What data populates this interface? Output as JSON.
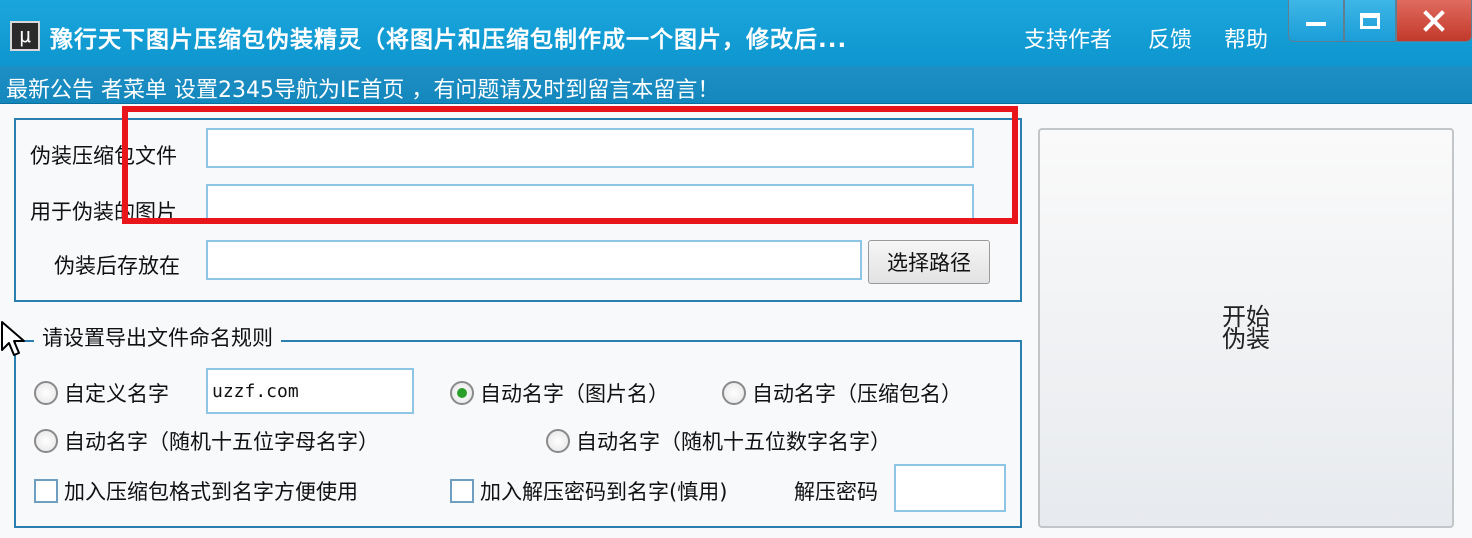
{
  "window": {
    "app_icon": "app-icon",
    "title": "豫行天下图片压缩包伪装精灵（将图片和压缩包制作成一个图片，修改后...",
    "links": {
      "support": "支持作者",
      "feedback": "反馈",
      "help": "帮助"
    },
    "controls": [
      "minimize-icon",
      "maximize-icon",
      "close-icon"
    ]
  },
  "notice": {
    "text": "最新公告 者菜单 设置2345导航为IE首页 ，有问题请及时到留言本留言！"
  },
  "files": {
    "archive_label": "伪装压缩包文件",
    "archive_value": "",
    "image_label": "用于伪装的图片",
    "image_value": "",
    "output_label": "伪装后存放在",
    "output_value": "",
    "browse_button": "选择路径"
  },
  "naming": {
    "legend": "请设置导出文件命名规则",
    "custom_label": "自定义名字",
    "custom_value": "uzzf.com",
    "auto_image_label": "自动名字（图片名）",
    "auto_archive_label": "自动名字（压缩包名）",
    "random_letters_label": "自动名字（随机十五位字母名字）",
    "random_digits_label": "自动名字（随机十五位数字名字）",
    "selected": "auto_image",
    "add_format_label": "加入压缩包格式到名字方便使用",
    "add_format_checked": false,
    "add_password_label": "加入解压密码到名字(慎用)",
    "add_password_checked": false,
    "password_label": "解压密码",
    "password_value": ""
  },
  "start_button": "开始伪装",
  "colors": {
    "titlebar": "#1aa6dc",
    "notice_bar": "#1487bd",
    "group_border": "#2a7fb0",
    "highlight": "#e8151b",
    "close_button": "#c2392b"
  }
}
